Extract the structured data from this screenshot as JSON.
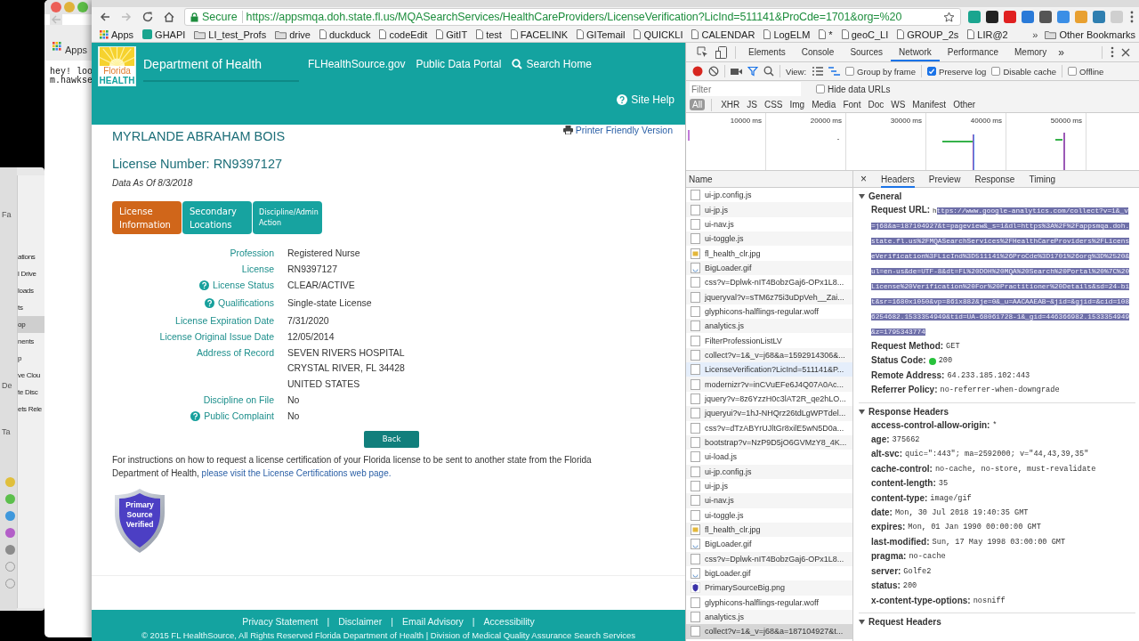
{
  "desktop": {
    "back_window": {
      "bookmark": "Apps",
      "text_lines": [
        "hey! loo",
        "m.hawkse"
      ]
    },
    "finder": {
      "section_labels": [
        "Fa",
        "De",
        "Ta"
      ],
      "items": [
        {
          "label": "ations",
          "selected": false
        },
        {
          "label": "l Drive",
          "selected": false
        },
        {
          "label": "loads",
          "selected": false
        },
        {
          "label": "ts",
          "selected": false
        },
        {
          "label": "op",
          "selected": true
        },
        {
          "label": "nents",
          "selected": false
        },
        {
          "label": "p",
          "selected": false
        },
        {
          "label": "ve Clou",
          "selected": false
        },
        {
          "label": "te Disc",
          "selected": false
        },
        {
          "label": "ets Rele",
          "selected": false
        }
      ],
      "tags": [
        {
          "color": "#e0bf3c",
          "kind": "filled"
        },
        {
          "color": "#5cbf4c",
          "kind": "filled"
        },
        {
          "color": "#3f98dc",
          "kind": "filled"
        },
        {
          "color": "#b35fc8",
          "kind": "filled"
        },
        {
          "color": "#8c8c8c",
          "kind": "filled"
        },
        {
          "color": "#9a9a9a",
          "kind": "outline"
        },
        {
          "color": "#9a9a9a",
          "kind": "outline"
        }
      ]
    }
  },
  "browser": {
    "secure_label": "Secure",
    "url": "https://appsmqa.doh.state.fl.us/MQASearchServices/HealthCareProviders/LicenseVerification?LicInd=511141&ProCde=1701&org=%20",
    "bookmarks": [
      {
        "label": "Apps",
        "kind": "apps"
      },
      {
        "label": "GHAPI",
        "kind": "app"
      },
      {
        "label": "LI_test_Profs",
        "kind": "folder"
      },
      {
        "label": "drive",
        "kind": "folder"
      },
      {
        "label": "duckduck",
        "kind": "page"
      },
      {
        "label": "codeEdit",
        "kind": "page"
      },
      {
        "label": "GitIT",
        "kind": "page"
      },
      {
        "label": "test",
        "kind": "page"
      },
      {
        "label": "FACELINK",
        "kind": "page"
      },
      {
        "label": "GITemail",
        "kind": "page"
      },
      {
        "label": "QUICKLI",
        "kind": "page"
      },
      {
        "label": "CALENDAR",
        "kind": "page"
      },
      {
        "label": "LogELM",
        "kind": "page"
      },
      {
        "label": "*",
        "kind": "page"
      },
      {
        "label": "geoC_LI",
        "kind": "page"
      },
      {
        "label": "GROUP_2s",
        "kind": "page"
      },
      {
        "label": "LIR@2",
        "kind": "page"
      }
    ],
    "more": "»",
    "other_bookmarks": "Other Bookmarks"
  },
  "site": {
    "logo": {
      "line1": "Florida",
      "line2": "HEALTH"
    },
    "title": "Department of Health",
    "nav": [
      {
        "label": "FLHealthSource.gov",
        "kind": "link"
      },
      {
        "label": "Public Data Portal",
        "kind": "link"
      },
      {
        "label": "Search Home",
        "kind": "search"
      }
    ],
    "site_help": "Site Help",
    "printer": "Printer Friendly Version",
    "name": "MYRLANDE ABRAHAM BOIS",
    "license_heading": "License Number: RN9397127",
    "data_as_of": "Data As Of 8/3/2018",
    "tabs": [
      {
        "label": "License Information",
        "selected": true
      },
      {
        "label": "Secondary Locations",
        "selected": false
      },
      {
        "label": "Discipline/Admin Action",
        "selected": false
      }
    ],
    "fields": [
      {
        "label": "Profession",
        "help": false,
        "values": [
          "Registered Nurse"
        ]
      },
      {
        "label": "License",
        "help": false,
        "values": [
          "RN9397127"
        ]
      },
      {
        "label": "License Status",
        "help": true,
        "values": [
          "CLEAR/ACTIVE"
        ]
      },
      {
        "label": "Qualifications",
        "help": true,
        "values": [
          "Single-state License"
        ]
      },
      {
        "label": "License Expiration Date",
        "help": false,
        "values": [
          "7/31/2020"
        ]
      },
      {
        "label": "License Original Issue Date",
        "help": false,
        "values": [
          "12/05/2014"
        ]
      },
      {
        "label": "Address of Record",
        "help": false,
        "values": [
          "SEVEN RIVERS HOSPITAL",
          "CRYSTAL RIVER, FL 34428",
          "UNITED STATES"
        ]
      },
      {
        "label": "Discipline on File",
        "help": false,
        "values": [
          "No"
        ]
      },
      {
        "label": "Public Complaint",
        "help": true,
        "values": [
          "No"
        ]
      }
    ],
    "back": "Back",
    "instructions": "For instructions on how to request a license certification of your Florida license to be sent to another state from the Florida Department of Health, ",
    "instructions_link": "please visit the License Certifications web page.",
    "badge": [
      "Primary",
      "Source",
      "Verified"
    ],
    "footer_links": [
      "Privacy Statement",
      "Disclaimer",
      "Email Advisory",
      "Accessibility"
    ],
    "separator": "|",
    "copyright": "© 2015 FL HealthSource, All Rights Reserved Florida Department of Health | Division of Medical Quality Assurance Search Services"
  },
  "devtools": {
    "tabs": [
      {
        "label": "Elements",
        "selected": false
      },
      {
        "label": "Console",
        "selected": false
      },
      {
        "label": "Sources",
        "selected": false
      },
      {
        "label": "Network",
        "selected": true
      },
      {
        "label": "Performance",
        "selected": false
      },
      {
        "label": "Memory",
        "selected": false
      }
    ],
    "more": "»",
    "view_label": "View:",
    "options": [
      {
        "label": "Group by frame",
        "checked": false
      },
      {
        "label": "Preserve log",
        "checked": true
      },
      {
        "label": "Disable cache",
        "checked": false
      },
      {
        "label": "Offline",
        "checked": false
      }
    ],
    "filter": {
      "placeholder": "Filter"
    },
    "hide_data_urls": {
      "label": "Hide data URLs",
      "checked": false
    },
    "types": [
      {
        "label": "All",
        "selected": true
      },
      {
        "label": "XHR",
        "selected": false
      },
      {
        "label": "JS",
        "selected": false
      },
      {
        "label": "CSS",
        "selected": false
      },
      {
        "label": "Img",
        "selected": false
      },
      {
        "label": "Media",
        "selected": false
      },
      {
        "label": "Font",
        "selected": false
      },
      {
        "label": "Doc",
        "selected": false
      },
      {
        "label": "WS",
        "selected": false
      },
      {
        "label": "Manifest",
        "selected": false
      },
      {
        "label": "Other",
        "selected": false
      }
    ],
    "ticks": [
      "10000 ms",
      "20000 ms",
      "30000 ms",
      "40000 ms",
      "50000 ms"
    ],
    "name_header": "Name",
    "requests": [
      {
        "name": "ui-jp.config.js",
        "kind": "file",
        "selected": false,
        "hovered": false
      },
      {
        "name": "ui-jp.js",
        "kind": "file",
        "selected": false,
        "hovered": false
      },
      {
        "name": "ui-nav.js",
        "kind": "file",
        "selected": false,
        "hovered": false
      },
      {
        "name": "ui-toggle.js",
        "kind": "file",
        "selected": false,
        "hovered": false
      },
      {
        "name": "fl_health_clr.jpg",
        "kind": "image",
        "selected": false,
        "hovered": false
      },
      {
        "name": "BigLoader.gif",
        "kind": "gif",
        "selected": false,
        "hovered": false
      },
      {
        "name": "css?v=Dplwk-nIT4BobzGaj6-OPx1L8...",
        "kind": "file",
        "selected": false,
        "hovered": false
      },
      {
        "name": "jqueryval?v=sTM6z75i3uDpVeh__Zai...",
        "kind": "file",
        "selected": false,
        "hovered": false
      },
      {
        "name": "glyphicons-halflings-regular.woff",
        "kind": "file",
        "selected": false,
        "hovered": false
      },
      {
        "name": "analytics.js",
        "kind": "file",
        "selected": false,
        "hovered": false
      },
      {
        "name": "FilterProfessionListLV",
        "kind": "file",
        "selected": false,
        "hovered": false
      },
      {
        "name": "collect?v=1&_v=j68&a=1592914306&...",
        "kind": "file",
        "selected": false,
        "hovered": false
      },
      {
        "name": "LicenseVerification?LicInd=511141&P...",
        "kind": "file",
        "selected": false,
        "hovered": true
      },
      {
        "name": "modernizr?v=inCVuEFe6J4Q07A0Ac...",
        "kind": "file",
        "selected": false,
        "hovered": false
      },
      {
        "name": "jquery?v=8z6YzzH0c3lAT2R_qe2hLO...",
        "kind": "file",
        "selected": false,
        "hovered": false
      },
      {
        "name": "jqueryui?v=1hJ-NHQrz26tdLgWPTdel...",
        "kind": "file",
        "selected": false,
        "hovered": false
      },
      {
        "name": "css?v=dTzABYrUJltGr8xilE5wN5D0a...",
        "kind": "file",
        "selected": false,
        "hovered": false
      },
      {
        "name": "bootstrap?v=NzP9D5jO6GVMzY8_4K...",
        "kind": "file",
        "selected": false,
        "hovered": false
      },
      {
        "name": "ui-load.js",
        "kind": "file",
        "selected": false,
        "hovered": false
      },
      {
        "name": "ui-jp.config.js",
        "kind": "file",
        "selected": false,
        "hovered": false
      },
      {
        "name": "ui-jp.js",
        "kind": "file",
        "selected": false,
        "hovered": false
      },
      {
        "name": "ui-nav.js",
        "kind": "file",
        "selected": false,
        "hovered": false
      },
      {
        "name": "ui-toggle.js",
        "kind": "file",
        "selected": false,
        "hovered": false
      },
      {
        "name": "fl_health_clr.jpg",
        "kind": "image",
        "selected": false,
        "hovered": false
      },
      {
        "name": "BigLoader.gif",
        "kind": "gif",
        "selected": false,
        "hovered": false
      },
      {
        "name": "css?v=Dplwk-nIT4BobzGaj6-OPx1L8...",
        "kind": "file",
        "selected": false,
        "hovered": false
      },
      {
        "name": "bigLoader.gif",
        "kind": "gif",
        "selected": false,
        "hovered": false
      },
      {
        "name": "PrimarySourceBig.png",
        "kind": "badge",
        "selected": false,
        "hovered": false
      },
      {
        "name": "glyphicons-halflings-regular.woff",
        "kind": "file",
        "selected": false,
        "hovered": false
      },
      {
        "name": "analytics.js",
        "kind": "file",
        "selected": false,
        "hovered": false
      },
      {
        "name": "collect?v=1&_v=j68&a=187104927&t...",
        "kind": "file",
        "selected": true,
        "hovered": false
      }
    ],
    "close": "×",
    "detail_tabs": [
      {
        "label": "Headers",
        "selected": true
      },
      {
        "label": "Preview",
        "selected": false
      },
      {
        "label": "Response",
        "selected": false
      },
      {
        "label": "Timing",
        "selected": false
      }
    ],
    "general": {
      "title": "General",
      "expanded": true,
      "url_label": "Request URL:",
      "url_unselected": "h",
      "url_selected": "ttps://www.google-analytics.com/collect?v=1&_v=j68&a=187104927&t=pageview&_s=1&dl=https%3A%2F%2Fappsmqa.doh.state.fl.us%2FMQASearchServices%2FHealthCareProviders%2FLicenseVerification%3FLicInd%3D511141%26ProCde%3D1701%26org%3D%2520&ul=en-us&de=UTF-8&dt=FL%20DOH%20MQA%20Search%20Portal%20%7C%20License%20Verification%20For%20Practitioner%20Details&sd=24-bit&sr=1680x1050&vp=861x882&je=0&_u=AACAAEAB~&jid=&gjid=&cid=1086254682.1533354949&tid=UA-68061728-1&_gid=446366982.1533354949&z=1795343774",
      "rows": [
        {
          "label": "Request Method:",
          "value": "GET",
          "kind": "plain"
        },
        {
          "label": "Status Code:",
          "value": "200",
          "kind": "status"
        },
        {
          "label": "Remote Address:",
          "value": "64.233.185.102:443",
          "kind": "plain"
        },
        {
          "label": "Referrer Policy:",
          "value": "no-referrer-when-downgrade",
          "kind": "plain"
        }
      ]
    },
    "response_headers": {
      "title": "Response Headers",
      "expanded": true,
      "rows": [
        {
          "label": "access-control-allow-origin:",
          "value": "*"
        },
        {
          "label": "age:",
          "value": "375662"
        },
        {
          "label": "alt-svc:",
          "value": "quic=\":443\"; ma=2592000; v=\"44,43,39,35\""
        },
        {
          "label": "cache-control:",
          "value": "no-cache, no-store, must-revalidate"
        },
        {
          "label": "content-length:",
          "value": "35"
        },
        {
          "label": "content-type:",
          "value": "image/gif"
        },
        {
          "label": "date:",
          "value": "Mon, 30 Jul 2018 19:40:35 GMT"
        },
        {
          "label": "expires:",
          "value": "Mon, 01 Jan 1990 00:00:00 GMT"
        },
        {
          "label": "last-modified:",
          "value": "Sun, 17 May 1998 03:00:00 GMT"
        },
        {
          "label": "pragma:",
          "value": "no-cache"
        },
        {
          "label": "server:",
          "value": "Golfe2"
        },
        {
          "label": "status:",
          "value": "200"
        },
        {
          "label": "x-content-type-options:",
          "value": "nosniff"
        }
      ]
    },
    "request_headers": {
      "title": "Request Headers",
      "expanded": true
    }
  }
}
